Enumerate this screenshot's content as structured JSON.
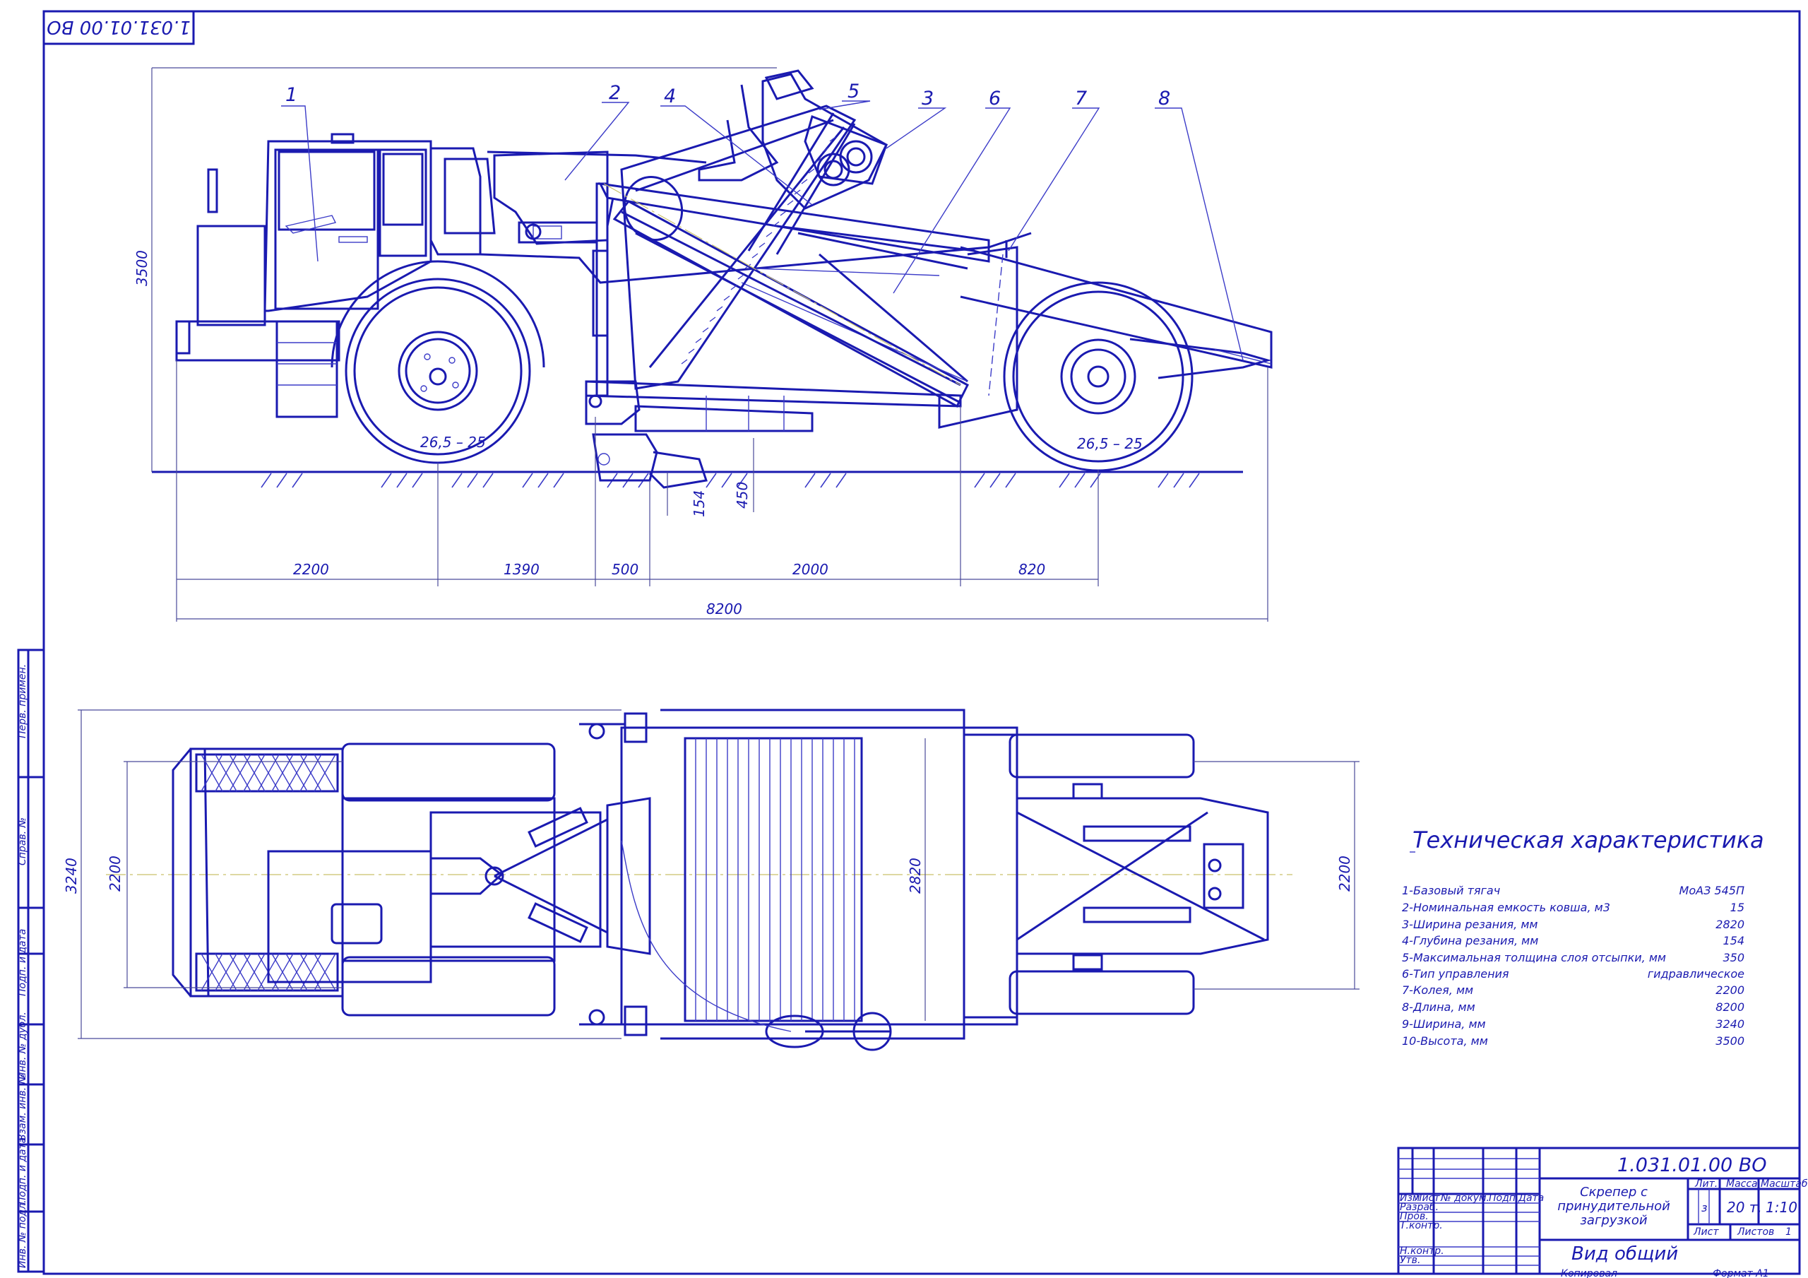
{
  "drawing": {
    "code": "1.031.01.00 ВО",
    "code_mirror": "1.031.01.00 ВО",
    "title": "Скрепер с принудительной загрузкой",
    "title_lines": [
      "Скрепер с",
      "принудительной",
      "загрузкой"
    ],
    "view": "Вид общий",
    "lit": "з",
    "mass": "20 т.",
    "scale": "1:10",
    "sheets_total": "1",
    "copied": "Копировал",
    "format": "Формат   А1"
  },
  "title_block": {
    "headers": {
      "lit": "Лит.",
      "mass": "Масса",
      "scale": "Масштаб",
      "sheet": "Лист",
      "sheets": "Листов"
    },
    "rev_headers": [
      "Изм",
      "Лист",
      "№ докум.",
      "Подп.",
      "Дата"
    ],
    "roles": [
      "Разраб.",
      "Пров.",
      "Т.контр.",
      "",
      "Н.контр.",
      "Утв."
    ]
  },
  "side_stamps": [
    "Перв. примен.",
    "Справ. №",
    "Подп. и дата",
    "Инв. № дубл.",
    "Взам. инв. №",
    "Подп. и дата",
    "Инв. № подл."
  ],
  "dimensions": {
    "height_total": "3500",
    "segments": [
      "2200",
      "1390",
      "500",
      "2000",
      "820"
    ],
    "length_total": "8200",
    "depth_cut": "154",
    "depth_450": "450",
    "tire_front": "26,5 – 25",
    "tire_rear": "26,5 – 25",
    "plan_width": "3240",
    "plan_track_left": "2200",
    "plan_bucket": "2820",
    "plan_track_right": "2200"
  },
  "callouts": [
    "1",
    "2",
    "4",
    "5",
    "3",
    "6",
    "7",
    "8"
  ],
  "specs": {
    "title": "Техническая характеристика",
    "rows": [
      {
        "label": "1-Базовый тягач",
        "value": "МоАЗ 545П"
      },
      {
        "label": "2-Номинальная емкость ковша, м3",
        "value": "15"
      },
      {
        "label": "3-Ширина резания, мм",
        "value": "2820"
      },
      {
        "label": "4-Глубина резания, мм",
        "value": "154"
      },
      {
        "label": "5-Максимальная толщина слоя отсыпки, мм",
        "value": "350"
      },
      {
        "label": "6-Тип управления",
        "value": "гидравлическое"
      },
      {
        "label": "7-Колея, мм",
        "value": "2200"
      },
      {
        "label": "8-Длина, мм",
        "value": "8200"
      },
      {
        "label": "9-Ширина, мм",
        "value": "3240"
      },
      {
        "label": "10-Высота, мм",
        "value": "3500"
      }
    ]
  }
}
